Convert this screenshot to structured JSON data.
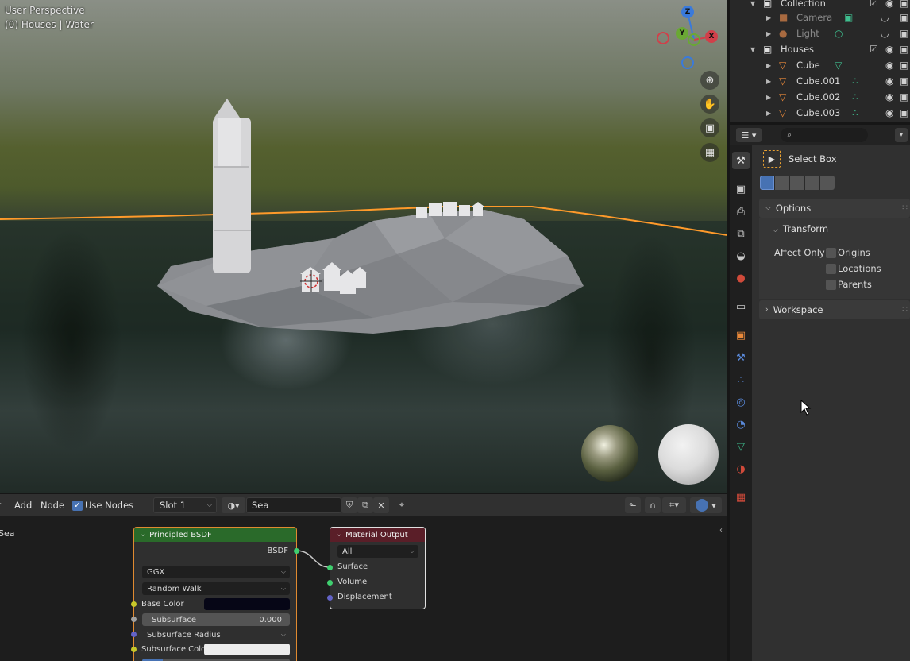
{
  "viewport": {
    "perspective_label": "User Perspective",
    "context_label": "(0) Houses | Water",
    "gizmo": {
      "z": "Z",
      "y": "Y",
      "x": "X"
    }
  },
  "outliner": {
    "rows": [
      {
        "label": "Collection",
        "type": "collection"
      },
      {
        "label": "Camera",
        "type": "camera"
      },
      {
        "label": "Light",
        "type": "light"
      },
      {
        "label": "Houses",
        "type": "collection"
      },
      {
        "label": "Cube",
        "type": "mesh"
      },
      {
        "label": "Cube.001",
        "type": "mesh"
      },
      {
        "label": "Cube.002",
        "type": "mesh"
      },
      {
        "label": "Cube.003",
        "type": "mesh"
      }
    ]
  },
  "properties": {
    "tool_name": "Select Box",
    "panels": {
      "options": "Options",
      "transform": "Transform",
      "affect_only": "Affect Only",
      "workspace": "Workspace"
    },
    "checkboxes": [
      {
        "label": "Origins",
        "checked": false
      },
      {
        "label": "Locations",
        "checked": false
      },
      {
        "label": "Parents",
        "checked": false
      }
    ]
  },
  "node_editor": {
    "header": {
      "menu_add": "Add",
      "menu_node": "Node",
      "use_nodes_label": "Use Nodes",
      "use_nodes_checked": true,
      "slot": "Slot 1",
      "material_name": "Sea"
    },
    "side_label": "Sea",
    "principled": {
      "title": "Principled BSDF",
      "output": "BSDF",
      "distribution": "GGX",
      "subsurface_method": "Random Walk",
      "base_color_label": "Base Color",
      "subsurface_label": "Subsurface",
      "subsurface_value": "0.000",
      "subsurface_radius_label": "Subsurface Radius",
      "subsurface_color_label": "Subsurface Color"
    },
    "material_output": {
      "title": "Material Output",
      "target": "All",
      "inputs": [
        "Surface",
        "Volume",
        "Displacement"
      ]
    }
  },
  "colors": {
    "accent_blue": "#4772b3",
    "shader_node_header": "#2a6a2a",
    "output_node_header": "#5a1e28",
    "mesh_orange": "#e8883a",
    "mesh_data_green": "#3fbf8f",
    "selection_orange": "#ff9a2a"
  }
}
